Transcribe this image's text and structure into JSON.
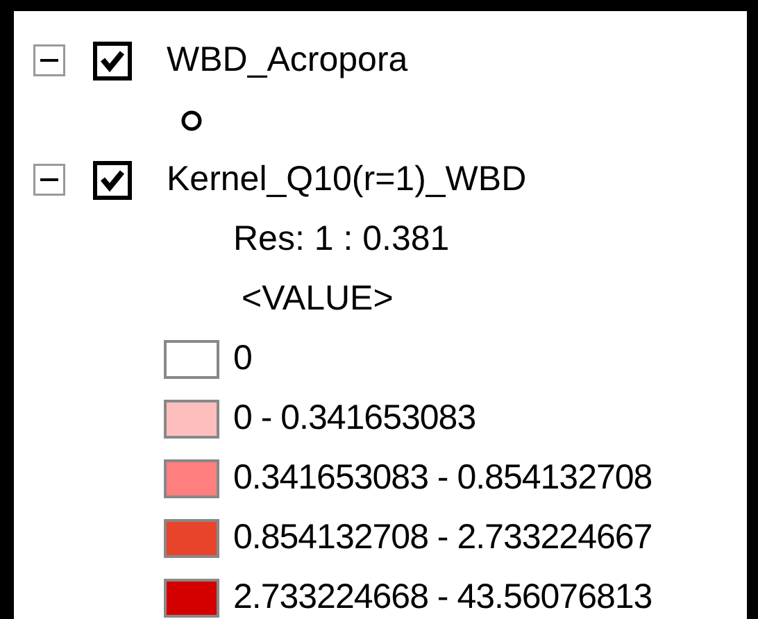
{
  "layers": [
    {
      "name": "WBD_Acropora",
      "expanded": true,
      "checked": true,
      "legend": [
        {
          "kind": "point-symbol"
        }
      ]
    },
    {
      "name": "Kernel_Q10(r=1)_WBD",
      "expanded": true,
      "checked": true,
      "legend": [
        {
          "kind": "text",
          "text": "Res: 1 : 0.381"
        },
        {
          "kind": "heading",
          "text": "<VALUE>"
        },
        {
          "kind": "class",
          "label": "0",
          "color": "#ffffff"
        },
        {
          "kind": "class",
          "label": "0 - 0.341653083",
          "color": "#ffbebe"
        },
        {
          "kind": "class",
          "label": "0.341653083 - 0.854132708",
          "color": "#ff7f7f"
        },
        {
          "kind": "class",
          "label": "0.854132708 - 2.733224667",
          "color": "#e8442c"
        },
        {
          "kind": "class",
          "label": "2.733224668 - 43.56076813",
          "color": "#d40000"
        }
      ]
    }
  ]
}
